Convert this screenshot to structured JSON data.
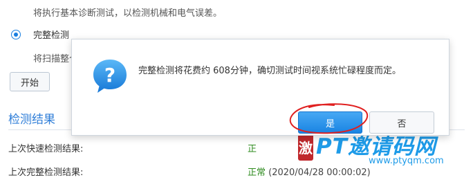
{
  "background": {
    "quick_desc": "将执行基本诊断测试，以检测机械和电气误差。",
    "complete_option_label": "完整检测",
    "complete_desc": "将扫描整个",
    "start_button": "开始",
    "results_title": "检测结果",
    "rows": [
      {
        "label": "上次快速检测结果:",
        "status": "正"
      },
      {
        "label": "上次完整检测结果:",
        "status": "正常",
        "time": "(2020/04/28 00:00:02)"
      }
    ]
  },
  "dialog": {
    "icon": "question-icon",
    "message": "完整检测将花费约 608分钟，确切测试时间视系统忙碌程度而定。",
    "yes_label": "是",
    "no_label": "否"
  },
  "watermark": {
    "badge": "激",
    "title": "PT邀请码网",
    "url": "www.ptyqm.com"
  },
  "colors": {
    "accent": "#1a84e2",
    "title_blue": "#2f7ed8",
    "ok_green": "#2e8b1e",
    "annotation_red": "#e02020"
  }
}
